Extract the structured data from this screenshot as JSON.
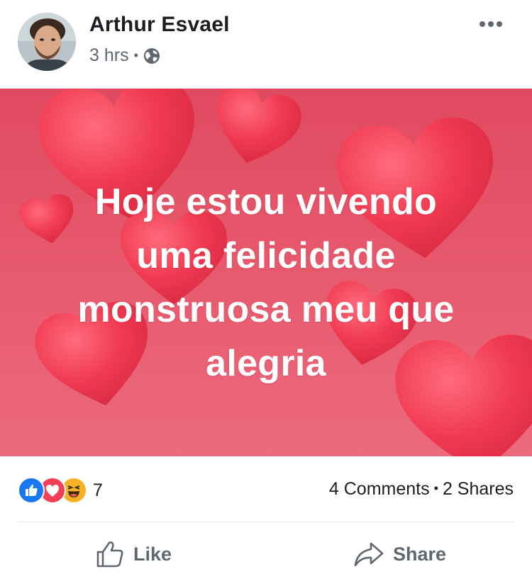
{
  "post": {
    "author": "Arthur Esvael",
    "time": "3 hrs",
    "time_separator": "•",
    "privacy_icon": "globe-icon",
    "more_icon": "more-options-icon",
    "text_lines": [
      "Hoje estou vivendo",
      "uma felicidade",
      "monstruosa meu que",
      "alegria"
    ],
    "background_color": "#e85b6f",
    "text_color": "#ffffff"
  },
  "stats": {
    "reactions": [
      {
        "name": "like",
        "icon": "like-reaction-icon",
        "color": "#1877f2"
      },
      {
        "name": "love",
        "icon": "love-reaction-icon",
        "color": "#f33e58"
      },
      {
        "name": "haha",
        "icon": "haha-reaction-icon",
        "color": "#f7b125"
      }
    ],
    "reaction_count": "7",
    "comments": "4 Comments",
    "separator": "•",
    "shares": "2 Shares"
  },
  "actions": {
    "like_label": "Like",
    "share_label": "Share"
  }
}
